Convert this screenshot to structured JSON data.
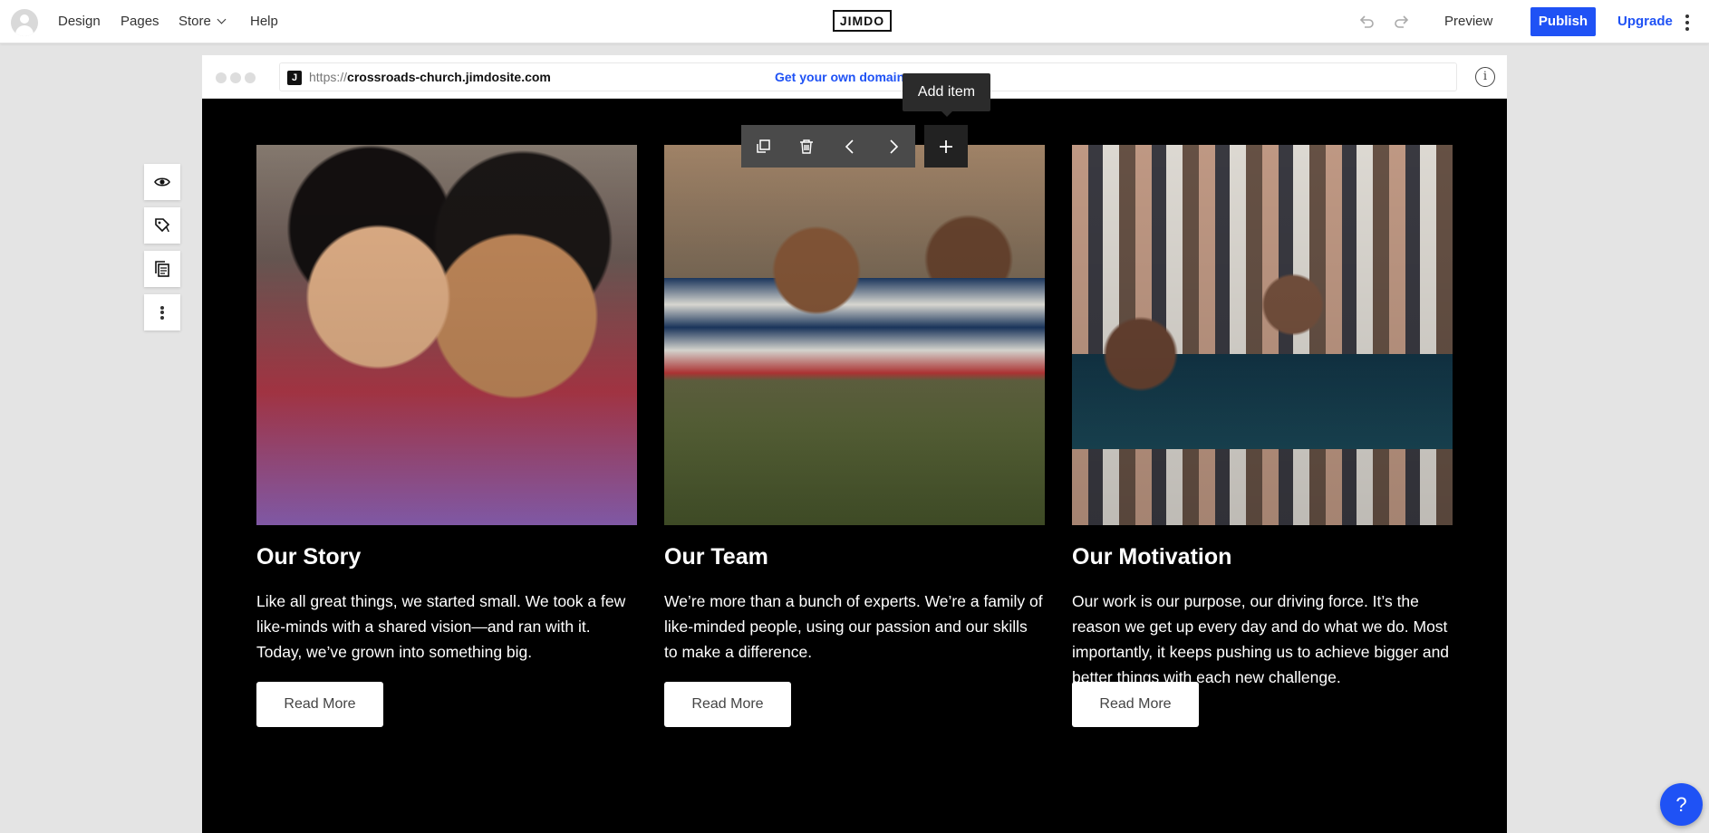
{
  "topbar": {
    "nav": {
      "design": "Design",
      "pages": "Pages",
      "store": "Store",
      "help": "Help"
    },
    "logo": "JIMDO",
    "preview": "Preview",
    "publish": "Publish",
    "upgrade": "Upgrade",
    "accent_color": "#1f52f5"
  },
  "browser": {
    "favicon_letter": "J",
    "url_protocol": "https://",
    "url_host": "crossroads-church.jimdosite.com",
    "domain_link": "Get your own domain",
    "info_icon": "i"
  },
  "toolbar": {
    "tooltip": "Add item",
    "icons": [
      "duplicate-icon",
      "trash-icon",
      "chevron-left-icon",
      "chevron-right-icon",
      "plus-icon"
    ]
  },
  "side_tools": {
    "icons": [
      "eye-icon",
      "paint-icon",
      "clipboard-icon",
      "more-icon"
    ]
  },
  "cards": [
    {
      "title": "Our Story",
      "text": "Like all great things, we started small. We took a few like-minds with a shared vision—and ran with it. Today, we’ve grown into something big.",
      "button": "Read More"
    },
    {
      "title": "Our Team",
      "text": "We’re more than a bunch of experts. We’re a family of like-minded people, using our passion and our skills to make a difference.",
      "button": "Read More"
    },
    {
      "title": "Our Motivation",
      "text": "Our work is our purpose, our driving force. It’s the reason we get up every day and do what we do. Most importantly, it keeps pushing us to achieve bigger and better things with each new challenge.",
      "button": "Read More"
    }
  ],
  "help_button": "?"
}
